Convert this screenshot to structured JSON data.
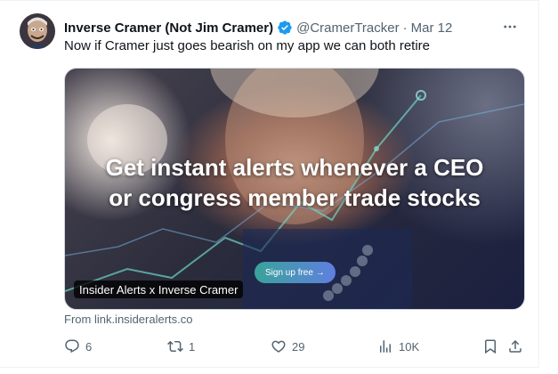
{
  "tweet": {
    "display_name": "Inverse Cramer (Not Jim Cramer)",
    "handle": "@CramerTracker",
    "separator": "·",
    "date": "Mar 12",
    "text": "Now if Cramer just goes bearish on my app we can both retire"
  },
  "card": {
    "headline_line1": "Get instant alerts whenever a CEO",
    "headline_line2": "or congress member trade stocks",
    "cta_label": "Sign up free →",
    "title": "Insider Alerts x Inverse Cramer",
    "source": "From link.insideralerts.co"
  },
  "actions": {
    "replies": "6",
    "reposts": "1",
    "likes": "29",
    "views": "10K"
  },
  "icons": {
    "more": "more-horizontal-icon",
    "verified": "verified-badge-icon",
    "reply": "reply-icon",
    "repost": "repost-icon",
    "like": "heart-icon",
    "views": "views-chart-icon",
    "bookmark": "bookmark-icon",
    "share": "share-icon"
  },
  "colors": {
    "verified": "#1d9bf0",
    "secondary_text": "#536471",
    "primary_text": "#0f1419"
  }
}
